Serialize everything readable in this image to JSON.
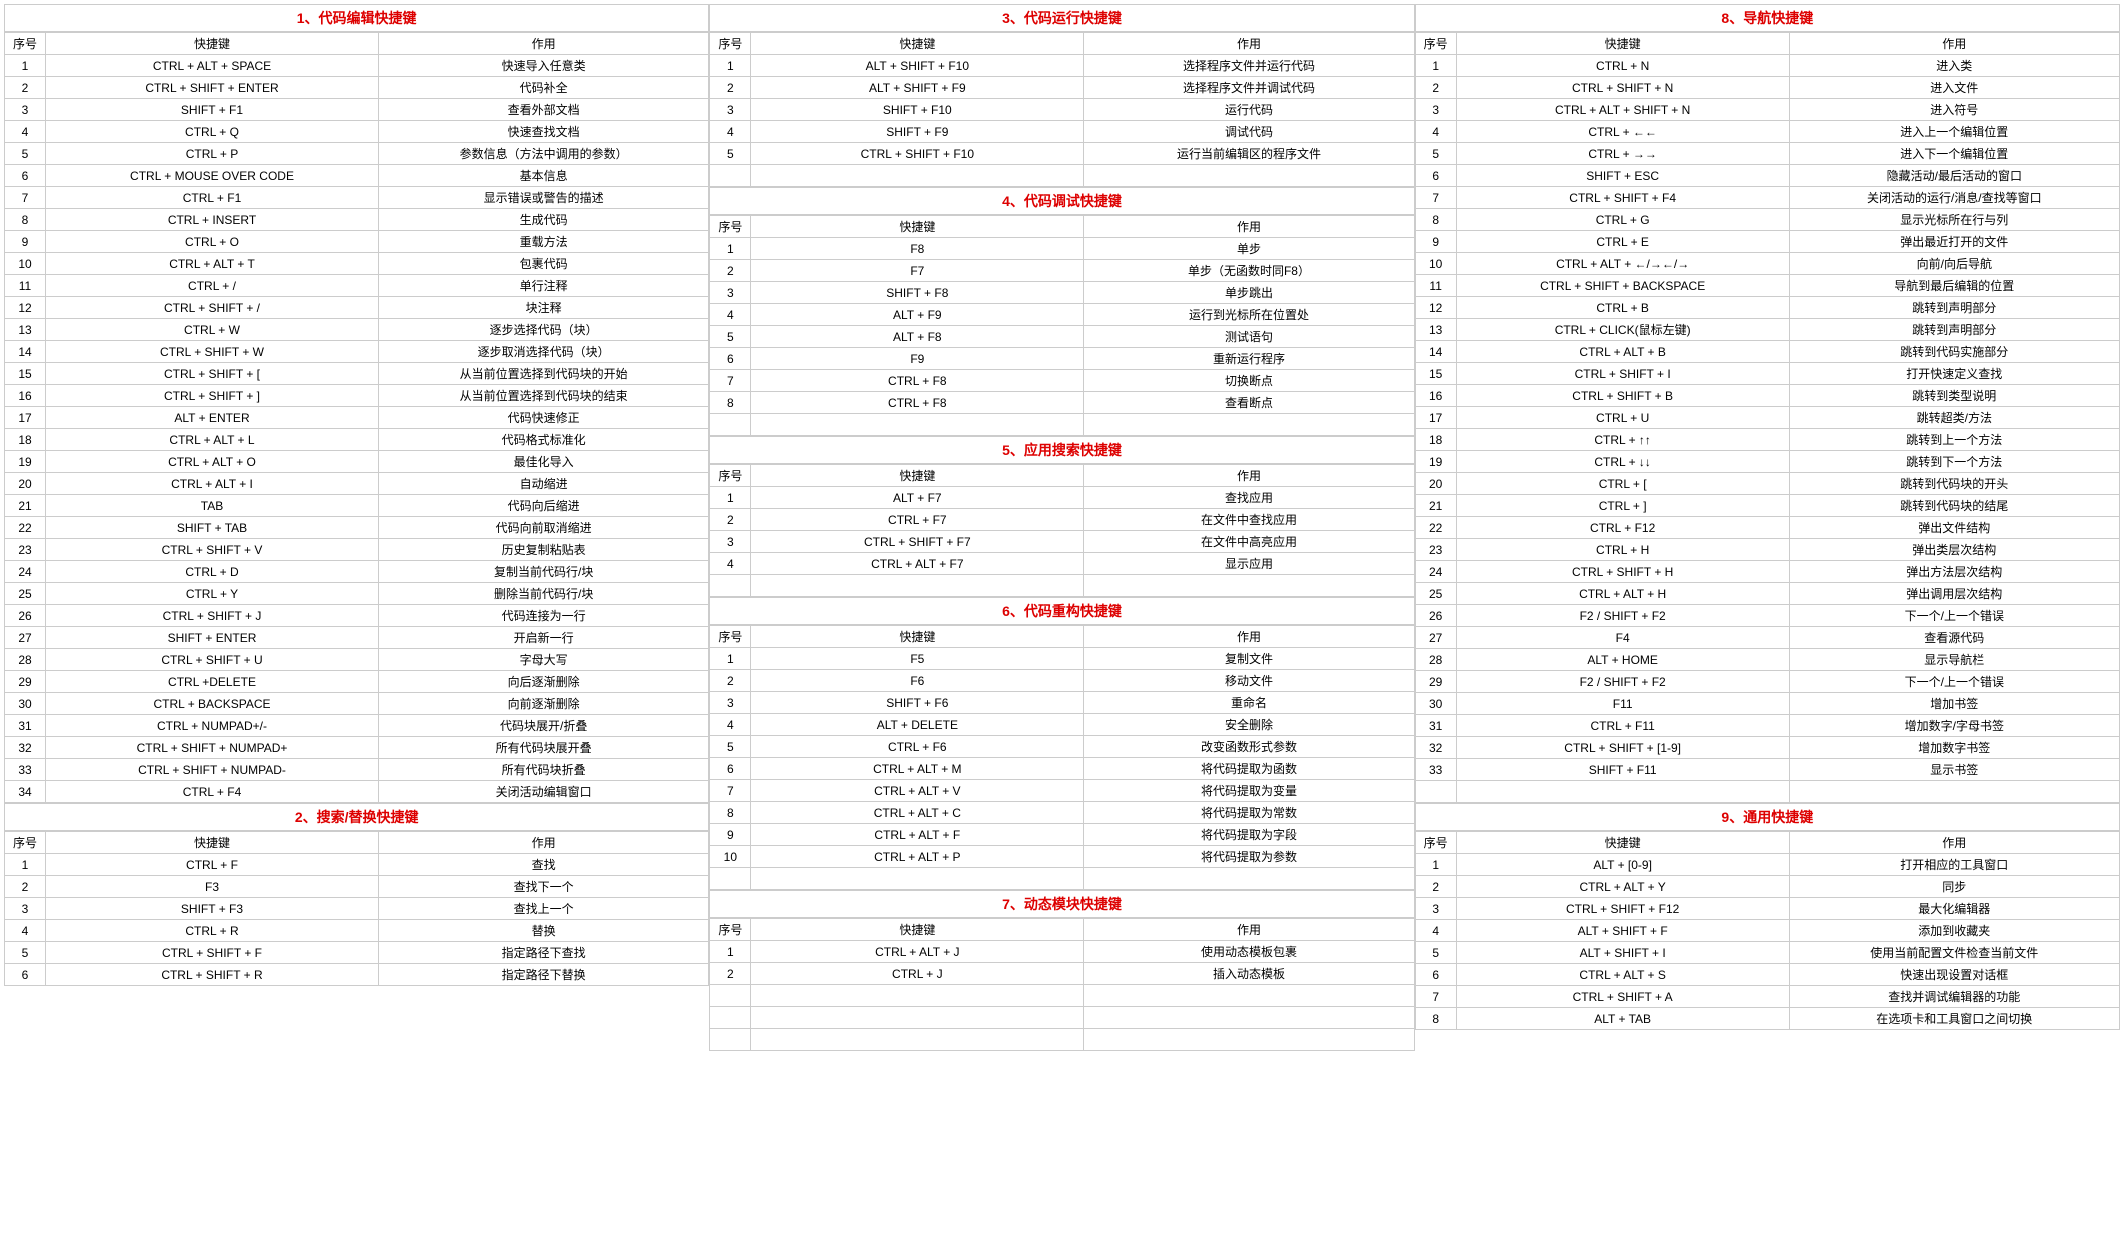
{
  "headers": {
    "num": "序号",
    "key": "快捷键",
    "act": "作用"
  },
  "columns": [
    {
      "sections": [
        {
          "title": "1、代码编辑快捷键",
          "rows": [
            [
              "1",
              "CTRL + ALT + SPACE",
              "快速导入任意类"
            ],
            [
              "2",
              "CTRL + SHIFT + ENTER",
              "代码补全"
            ],
            [
              "3",
              "SHIFT + F1",
              "查看外部文档"
            ],
            [
              "4",
              "CTRL + Q",
              "快速查找文档"
            ],
            [
              "5",
              "CTRL + P",
              "参数信息（方法中调用的参数）"
            ],
            [
              "6",
              "CTRL + MOUSE OVER CODE",
              "基本信息"
            ],
            [
              "7",
              "CTRL + F1",
              "显示错误或警告的描述"
            ],
            [
              "8",
              "CTRL + INSERT",
              "生成代码"
            ],
            [
              "9",
              "CTRL + O",
              "重载方法"
            ],
            [
              "10",
              "CTRL + ALT + T",
              "包裹代码"
            ],
            [
              "11",
              "CTRL + /",
              "单行注释"
            ],
            [
              "12",
              "CTRL + SHIFT + /",
              "块注释"
            ],
            [
              "13",
              "CTRL + W",
              "逐步选择代码（块）"
            ],
            [
              "14",
              "CTRL + SHIFT + W",
              "逐步取消选择代码（块）"
            ],
            [
              "15",
              "CTRL + SHIFT + [",
              "从当前位置选择到代码块的开始"
            ],
            [
              "16",
              "CTRL + SHIFT + ]",
              "从当前位置选择到代码块的结束"
            ],
            [
              "17",
              "ALT + ENTER",
              "代码快速修正"
            ],
            [
              "18",
              "CTRL + ALT + L",
              "代码格式标准化"
            ],
            [
              "19",
              "CTRL + ALT + O",
              "最佳化导入"
            ],
            [
              "20",
              "CTRL + ALT + I",
              "自动缩进"
            ],
            [
              "21",
              "TAB",
              "代码向后缩进"
            ],
            [
              "22",
              "SHIFT + TAB",
              "代码向前取消缩进"
            ],
            [
              "23",
              "CTRL + SHIFT + V",
              "历史复制粘贴表"
            ],
            [
              "24",
              "CTRL + D",
              "复制当前代码行/块"
            ],
            [
              "25",
              "CTRL + Y",
              "删除当前代码行/块"
            ],
            [
              "26",
              "CTRL + SHIFT + J",
              "代码连接为一行"
            ],
            [
              "27",
              "SHIFT + ENTER",
              "开启新一行"
            ],
            [
              "28",
              "CTRL + SHIFT + U",
              "字母大写"
            ],
            [
              "29",
              "CTRL +DELETE",
              "向后逐渐删除"
            ],
            [
              "30",
              "CTRL + BACKSPACE",
              "向前逐渐删除"
            ],
            [
              "31",
              "CTRL + NUMPAD+/-",
              "代码块展开/折叠"
            ],
            [
              "32",
              "CTRL + SHIFT + NUMPAD+",
              "所有代码块展开叠"
            ],
            [
              "33",
              "CTRL + SHIFT + NUMPAD-",
              "所有代码块折叠"
            ],
            [
              "34",
              "CTRL + F4",
              "关闭活动编辑窗口"
            ]
          ]
        },
        {
          "title": "2、搜索/替换快捷键",
          "rows": [
            [
              "1",
              "CTRL + F",
              "查找"
            ],
            [
              "2",
              "F3",
              "查找下一个"
            ],
            [
              "3",
              "SHIFT + F3",
              "查找上一个"
            ],
            [
              "4",
              "CTRL + R",
              "替换"
            ],
            [
              "5",
              "CTRL + SHIFT + F",
              "指定路径下查找"
            ],
            [
              "6",
              "CTRL + SHIFT + R",
              "指定路径下替换"
            ]
          ]
        }
      ]
    },
    {
      "sections": [
        {
          "title": "3、代码运行快捷键",
          "rows": [
            [
              "1",
              "ALT + SHIFT + F10",
              "选择程序文件并运行代码"
            ],
            [
              "2",
              "ALT + SHIFT + F9",
              "选择程序文件并调试代码"
            ],
            [
              "3",
              "SHIFT + F10",
              "运行代码"
            ],
            [
              "4",
              "SHIFT + F9",
              "调试代码"
            ],
            [
              "5",
              "CTRL + SHIFT + F10",
              "运行当前编辑区的程序文件"
            ]
          ],
          "trailingEmpty": 1
        },
        {
          "title": "4、代码调试快捷键",
          "rows": [
            [
              "1",
              "F8",
              "单步"
            ],
            [
              "2",
              "F7",
              "单步（无函数时同F8）"
            ],
            [
              "3",
              "SHIFT + F8",
              "单步跳出"
            ],
            [
              "4",
              "ALT + F9",
              "运行到光标所在位置处"
            ],
            [
              "5",
              "ALT + F8",
              "测试语句"
            ],
            [
              "6",
              "F9",
              "重新运行程序"
            ],
            [
              "7",
              "CTRL + F8",
              "切换断点"
            ],
            [
              "8",
              "CTRL + F8",
              "查看断点"
            ]
          ],
          "trailingEmpty": 1
        },
        {
          "title": "5、应用搜索快捷键",
          "rows": [
            [
              "1",
              "ALT + F7",
              "查找应用"
            ],
            [
              "2",
              "CTRL + F7",
              "在文件中查找应用"
            ],
            [
              "3",
              "CTRL + SHIFT + F7",
              "在文件中高亮应用"
            ],
            [
              "4",
              "CTRL + ALT + F7",
              "显示应用"
            ]
          ],
          "trailingEmpty": 1
        },
        {
          "title": "6、代码重构快捷键",
          "rows": [
            [
              "1",
              "F5",
              "复制文件"
            ],
            [
              "2",
              "F6",
              "移动文件"
            ],
            [
              "3",
              "SHIFT + F6",
              "重命名"
            ],
            [
              "4",
              "ALT + DELETE",
              "安全删除"
            ],
            [
              "5",
              "CTRL + F6",
              "改变函数形式参数"
            ],
            [
              "6",
              "CTRL + ALT + M",
              "将代码提取为函数"
            ],
            [
              "7",
              "CTRL + ALT + V",
              "将代码提取为变量"
            ],
            [
              "8",
              "CTRL + ALT + C",
              "将代码提取为常数"
            ],
            [
              "9",
              "CTRL + ALT + F",
              "将代码提取为字段"
            ],
            [
              "10",
              "CTRL + ALT + P",
              "将代码提取为参数"
            ]
          ],
          "trailingEmpty": 1
        },
        {
          "title": "7、动态模块快捷键",
          "rows": [
            [
              "1",
              "CTRL + ALT + J",
              "使用动态模板包裹"
            ],
            [
              "2",
              "CTRL + J",
              "插入动态模板"
            ]
          ],
          "trailingEmpty": 3
        }
      ]
    },
    {
      "sections": [
        {
          "title": "8、导航快捷键",
          "rows": [
            [
              "1",
              "CTRL + N",
              "进入类"
            ],
            [
              "2",
              "CTRL + SHIFT + N",
              "进入文件"
            ],
            [
              "3",
              "CTRL + ALT + SHIFT + N",
              "进入符号"
            ],
            [
              "4",
              "CTRL + ←←",
              "进入上一个编辑位置"
            ],
            [
              "5",
              "CTRL + →→",
              "进入下一个编辑位置"
            ],
            [
              "6",
              "SHIFT + ESC",
              "隐藏活动/最后活动的窗口"
            ],
            [
              "7",
              "CTRL + SHIFT + F4",
              "关闭活动的运行/消息/查找等窗口"
            ],
            [
              "8",
              "CTRL + G",
              "显示光标所在行与列"
            ],
            [
              "9",
              "CTRL + E",
              "弹出最近打开的文件"
            ],
            [
              "10",
              "CTRL + ALT + ←/→←/→",
              "向前/向后导航"
            ],
            [
              "11",
              "CTRL + SHIFT + BACKSPACE",
              "导航到最后编辑的位置"
            ],
            [
              "12",
              "CTRL + B",
              "跳转到声明部分"
            ],
            [
              "13",
              "CTRL + CLICK(鼠标左键)",
              "跳转到声明部分"
            ],
            [
              "14",
              "CTRL + ALT + B",
              "跳转到代码实施部分"
            ],
            [
              "15",
              "CTRL + SHIFT + I",
              "打开快速定义查找"
            ],
            [
              "16",
              "CTRL + SHIFT + B",
              "跳转到类型说明"
            ],
            [
              "17",
              "CTRL + U",
              "跳转超类/方法"
            ],
            [
              "18",
              "CTRL + ↑↑",
              "跳转到上一个方法"
            ],
            [
              "19",
              "CTRL + ↓↓",
              "跳转到下一个方法"
            ],
            [
              "20",
              "CTRL + [",
              "跳转到代码块的开头"
            ],
            [
              "21",
              "CTRL + ]",
              "跳转到代码块的结尾"
            ],
            [
              "22",
              "CTRL + F12",
              "弹出文件结构"
            ],
            [
              "23",
              "CTRL + H",
              "弹出类层次结构"
            ],
            [
              "24",
              "CTRL + SHIFT + H",
              "弹出方法层次结构"
            ],
            [
              "25",
              "CTRL + ALT + H",
              "弹出调用层次结构"
            ],
            [
              "26",
              "F2 / SHIFT + F2",
              "下一个/上一个错误"
            ],
            [
              "27",
              "F4",
              "查看源代码"
            ],
            [
              "28",
              "ALT + HOME",
              "显示导航栏"
            ],
            [
              "29",
              "F2 / SHIFT + F2",
              "下一个/上一个错误"
            ],
            [
              "30",
              "F11",
              "增加书签"
            ],
            [
              "31",
              "CTRL + F11",
              "增加数字/字母书签"
            ],
            [
              "32",
              "CTRL + SHIFT + [1-9]",
              "增加数字书签"
            ],
            [
              "33",
              "SHIFT + F11",
              "显示书签"
            ]
          ],
          "trailingEmpty": 1
        },
        {
          "title": "9、通用快捷键",
          "rows": [
            [
              "1",
              "ALT + [0-9]",
              "打开相应的工具窗口"
            ],
            [
              "2",
              "CTRL + ALT + Y",
              "同步"
            ],
            [
              "3",
              "CTRL + SHIFT + F12",
              "最大化编辑器"
            ],
            [
              "4",
              "ALT + SHIFT + F",
              "添加到收藏夹"
            ],
            [
              "5",
              "ALT + SHIFT + I",
              "使用当前配置文件检查当前文件"
            ],
            [
              "6",
              "CTRL + ALT + S",
              "快速出现设置对话框"
            ],
            [
              "7",
              "CTRL + SHIFT + A",
              "查找并调试编辑器的功能"
            ],
            [
              "8",
              "ALT + TAB",
              "在选项卡和工具窗口之间切换"
            ]
          ]
        }
      ]
    }
  ]
}
